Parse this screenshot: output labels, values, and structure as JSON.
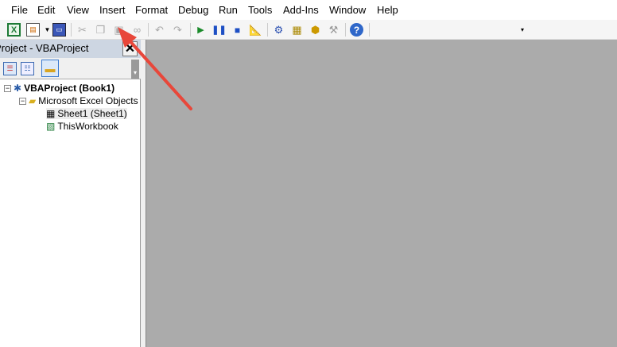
{
  "menu": [
    "File",
    "Edit",
    "View",
    "Insert",
    "Format",
    "Debug",
    "Run",
    "Tools",
    "Add-Ins",
    "Window",
    "Help"
  ],
  "toolbar": {
    "icons": [
      "excel-icon",
      "insert-userform-icon",
      "dropdown-icon",
      "save-icon",
      "cut-icon",
      "copy-icon",
      "paste-icon",
      "find-icon",
      "undo-icon",
      "redo-icon",
      "run-icon",
      "break-icon",
      "reset-icon",
      "design-mode-icon",
      "project-explorer-icon",
      "properties-window-icon",
      "object-browser-icon",
      "toolbox-icon",
      "help-icon"
    ]
  },
  "project_panel": {
    "title": "Project - VBAProject",
    "close": "✕"
  },
  "tree": {
    "root": "VBAProject (Book1)",
    "folder": "Microsoft Excel Objects",
    "items": [
      "Sheet1 (Sheet1)",
      "ThisWorkbook"
    ]
  },
  "colors": {
    "workspace": "#ababab",
    "arrow": "#e8473a",
    "title": "#cdd6e2"
  }
}
